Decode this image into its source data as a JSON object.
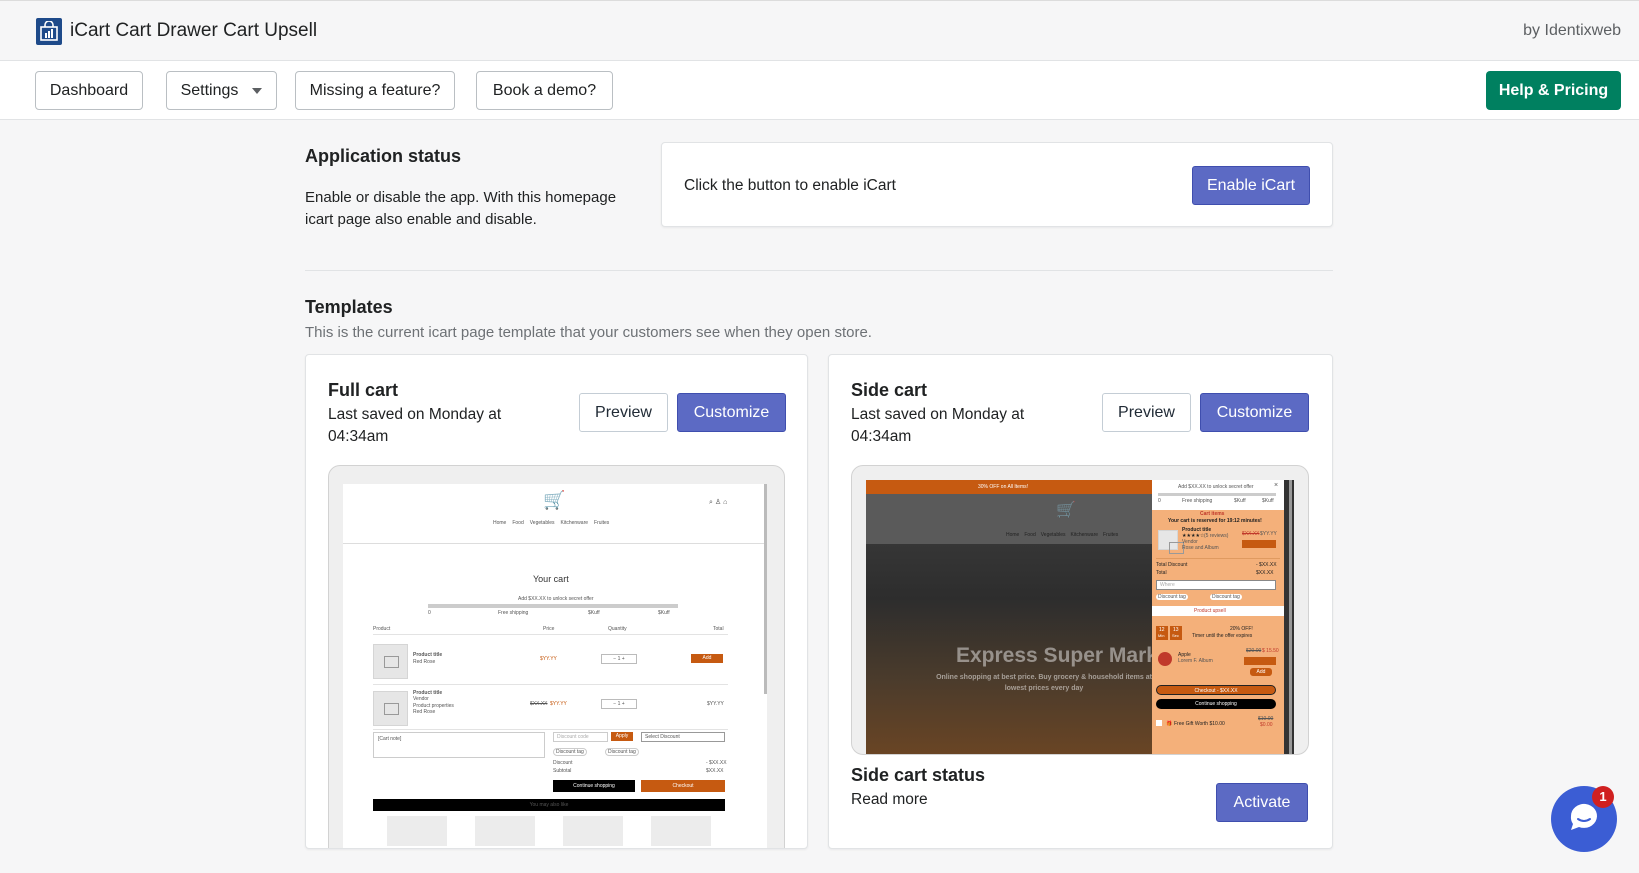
{
  "app": {
    "title": "iCart Cart Drawer Cart Upsell",
    "by": "by Identixweb"
  },
  "nav": {
    "dashboard": "Dashboard",
    "settings": "Settings",
    "missing_feature": "Missing a feature?",
    "book_demo": "Book a demo?",
    "help_pricing": "Help & Pricing"
  },
  "app_status": {
    "title": "Application status",
    "description": "Enable or disable the app. With this homepage icart page also enable and disable.",
    "prompt": "Click the button to enable iCart",
    "enable_button": "Enable iCart"
  },
  "templates": {
    "title": "Templates",
    "description": "This is the current icart page template that your customers see when they open store.",
    "full_cart": {
      "title": "Full cart",
      "saved": "Last saved on Monday at 04:34am",
      "preview": "Preview",
      "customize": "Customize",
      "mock": {
        "nav": [
          "Home",
          "Food",
          "Vegetables",
          "Kitchenware",
          "Fruites"
        ],
        "heading": "Your cart",
        "unlock": "Add $XX.XX to unlock secret offer",
        "milestones": [
          "0",
          "Free shipping",
          "$Kuff",
          "$Kuff"
        ],
        "columns": [
          "Product",
          "Price",
          "Quantity",
          "Total"
        ],
        "item1": {
          "title": "Product title",
          "variant": "Red Rose",
          "price": "$YY.YY",
          "add": "Add"
        },
        "item2": {
          "title": "Product title",
          "vendor": "Vendor",
          "props": "Product properties",
          "variant": "Red Rose",
          "compare": "$XX.XX",
          "price": "$YY.YY",
          "total": "$YY.YY"
        },
        "note": "[Cart note]",
        "discount_placeholder": "Discount code",
        "apply": "Apply",
        "select_discount": "Select Discount",
        "tags": [
          "Discount tag",
          "Discount tag"
        ],
        "discount_label": "Discount",
        "discount_value": "- $XX.XX",
        "subtotal_label": "Subtotal",
        "subtotal_value": "$XX.XX",
        "continue": "Continue shopping",
        "checkout": "Checkout",
        "may_like": "You may also like"
      }
    },
    "side_cart": {
      "title": "Side cart",
      "saved": "Last saved on Monday at 04:34am",
      "preview": "Preview",
      "customize": "Customize",
      "status_title": "Side cart status",
      "read_more": "Read more",
      "activate": "Activate",
      "mock": {
        "announcement": "30% OFF on All Items!",
        "store_name": "Express Super Market",
        "store_tagline": "Online shopping at best price. Buy grocery & household items at lowest prices every day",
        "nav": [
          "Home",
          "Food",
          "Vegetables",
          "Kitchenware",
          "Fruites"
        ],
        "unlock": "Add $XX.XX to unlock secret offer",
        "milestones": [
          "0",
          "Free shipping",
          "$Kuff",
          "$Kuff"
        ],
        "cart_items": "Cart items",
        "reserved": "Your cart is reserved for 19:12 minutes!",
        "product_title": "Product title",
        "reviews": "(5 reviews)",
        "vendor": "Vendor",
        "variant": "Rose and Album",
        "compare": "$XX.XX",
        "price": "$YY.YY",
        "total_discount": "Total Discount",
        "total_discount_value": "- $XX.XX",
        "total": "Total",
        "total_value": "$XX.XX",
        "note_placeholder": "Where",
        "tags": [
          "Discount tag",
          "Discount tag"
        ],
        "upsell": "Product upsell",
        "timer": [
          "12",
          "13"
        ],
        "timer_units": [
          "Min",
          "Sec"
        ],
        "offer": "20% OFF!",
        "offer_sub": "Timer until the offer expires",
        "apple": "Apple",
        "apple_sub": "Lorem F. Album",
        "apple_compare": "$20.00",
        "apple_price": "$ 15.50",
        "add": "Add",
        "checkout": "Checkout - $XX.XX",
        "continue": "Continue shopping",
        "gift": "Free Gift Worth $10.00",
        "gift_compare": "$10.00",
        "gift_price": "$0.00"
      }
    }
  },
  "chat": {
    "badge": "1"
  }
}
